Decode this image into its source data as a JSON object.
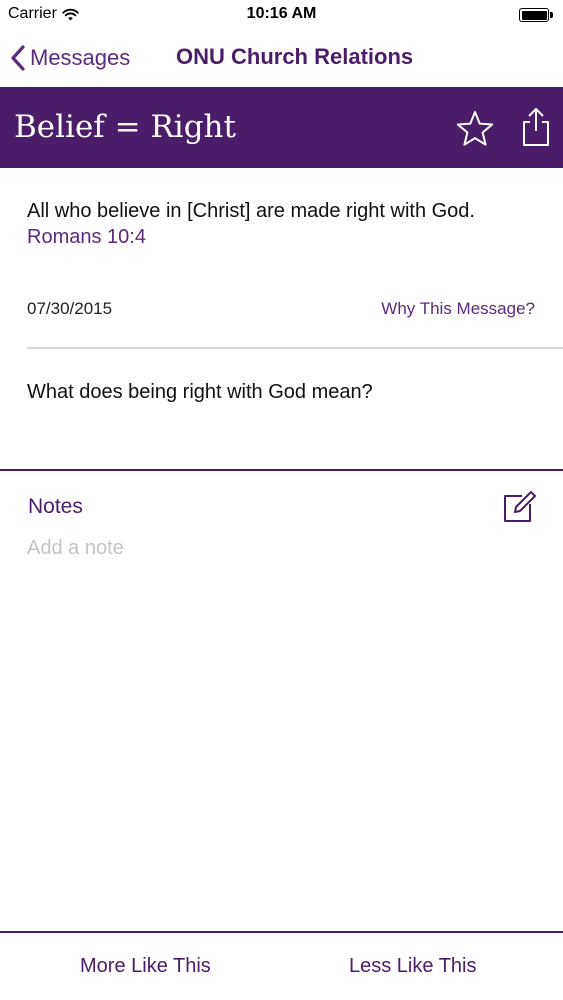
{
  "status_bar": {
    "carrier": "Carrier",
    "time": "10:16 AM",
    "battery_level": 1.0
  },
  "nav": {
    "back_label": "Messages",
    "title": "ONU Church Relations"
  },
  "banner": {
    "title": "Belief = Right",
    "star_icon": "star-outline-icon",
    "share_icon": "share-icon"
  },
  "message": {
    "verse": "All who believe in [Christ] are made right with God.",
    "reference": "Romans 10:4",
    "date": "07/30/2015",
    "why_link": "Why This Message?",
    "question": "What does being right with God mean?"
  },
  "notes": {
    "label": "Notes",
    "placeholder": "Add a note",
    "value": ""
  },
  "actions": {
    "more_label": "More Like This",
    "less_label": "Less Like This"
  },
  "colors": {
    "brand_purple": "#4a1d6b",
    "link_purple": "#5b2a7e",
    "divider": "#d8d4dc",
    "placeholder": "#c4c4c8"
  }
}
